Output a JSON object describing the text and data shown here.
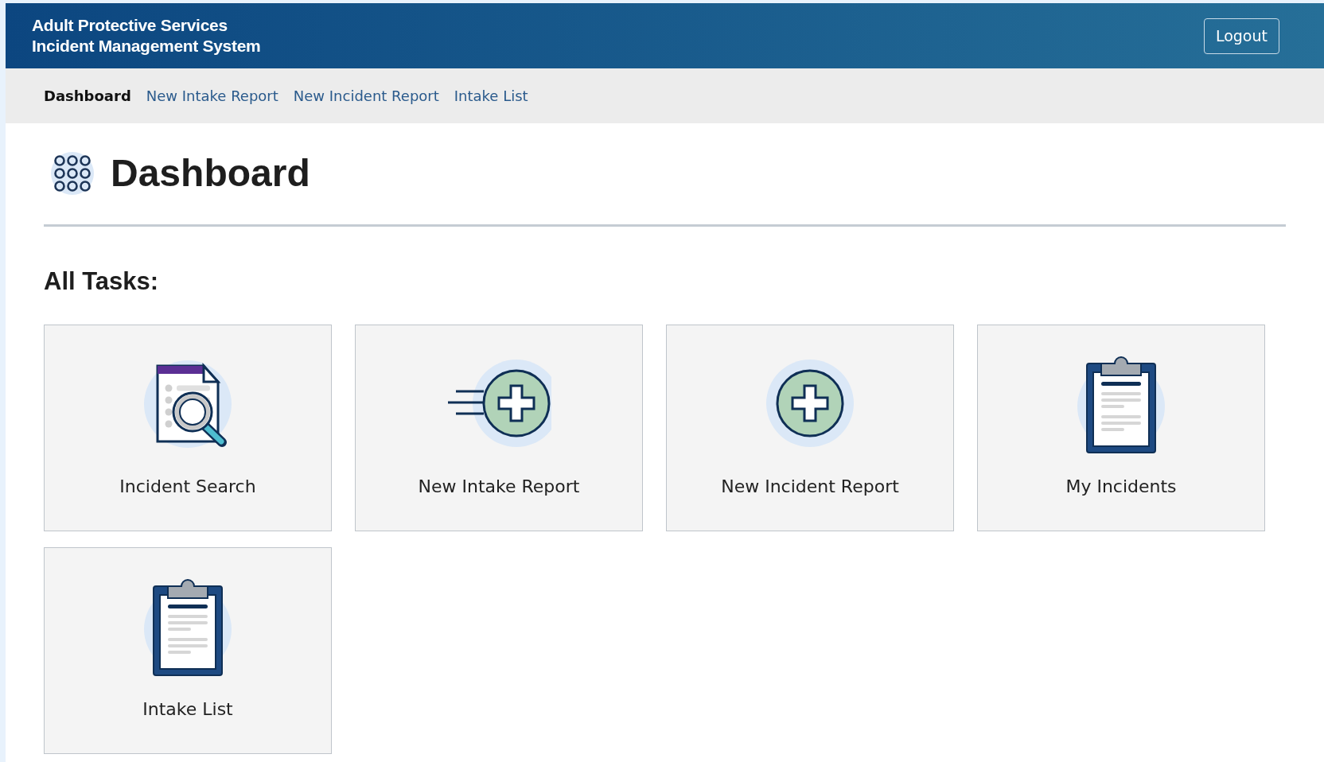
{
  "header": {
    "title_lines": [
      "Adult Protective Services",
      "Incident Management System"
    ],
    "logout": "Logout"
  },
  "nav": [
    {
      "label": "Dashboard",
      "selected": true
    },
    {
      "label": "New Intake Report",
      "selected": false
    },
    {
      "label": "New Incident Report",
      "selected": false
    },
    {
      "label": "Intake List",
      "selected": false
    }
  ],
  "page_title": "Dashboard",
  "section_title": "All Tasks:",
  "tasks": [
    {
      "label": "Incident Search",
      "kind": "search"
    },
    {
      "label": "New Intake Report",
      "kind": "fast-add"
    },
    {
      "label": "New Incident Report",
      "kind": "add"
    },
    {
      "label": "My Incidents",
      "kind": "clipboard"
    },
    {
      "label": "Intake List",
      "kind": "clipboard"
    }
  ]
}
